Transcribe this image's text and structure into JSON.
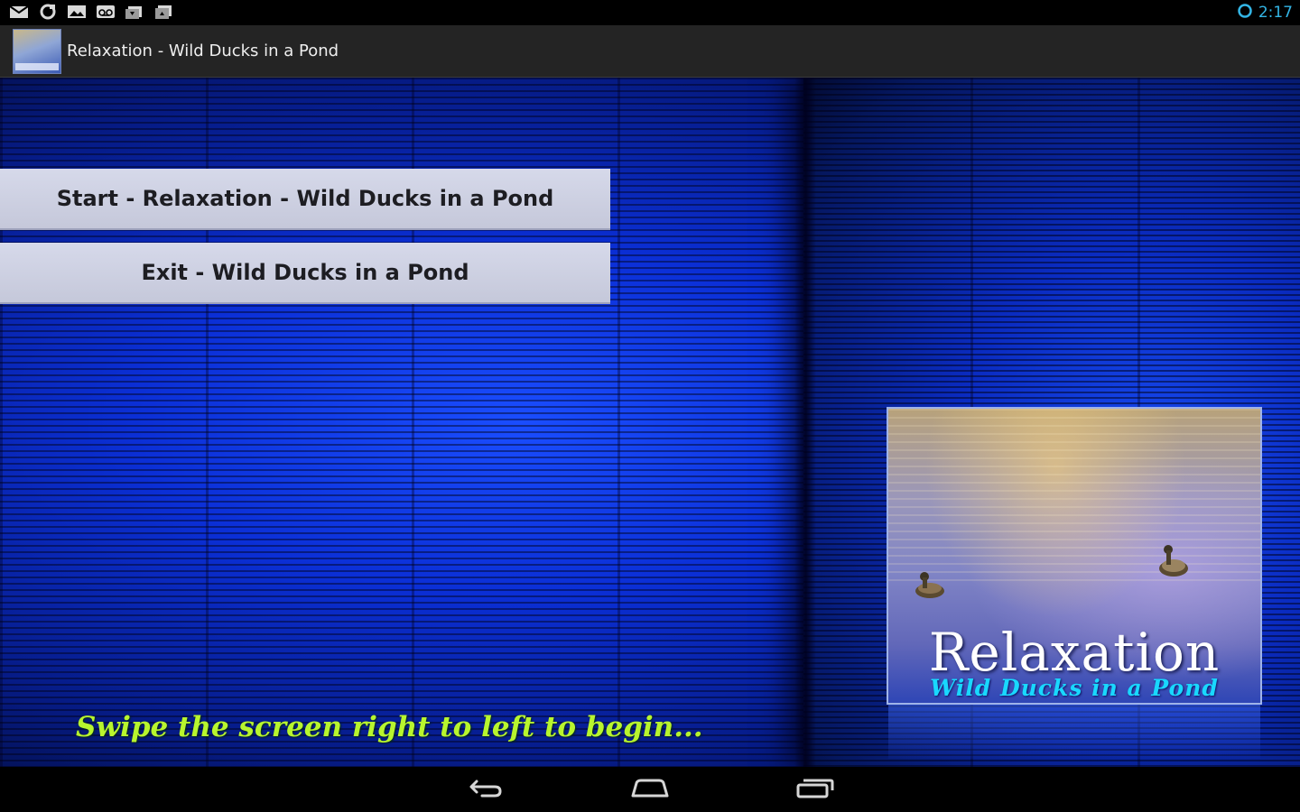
{
  "status_bar": {
    "notification_icons": [
      "mail-icon",
      "sync-icon",
      "image-icon",
      "voicemail-icon",
      "download-icon",
      "upload-icon"
    ],
    "time": "2:17",
    "sync_indicator": "circle-icon",
    "clock_color": "#33b5e5"
  },
  "action_bar": {
    "title": "Relaxation - Wild Ducks in a Pond",
    "app_icon": "app-icon"
  },
  "menu": {
    "start_label": "Start - Relaxation - Wild Ducks in a Pond",
    "exit_label": "Exit - Wild Ducks in a Pond"
  },
  "hint": {
    "text": "Swipe the screen right to left to begin...",
    "color": "#b8f52e"
  },
  "album_art": {
    "title": "Relaxation",
    "subtitle": "Wild Ducks in a Pond",
    "subtitle_color": "#19d8ff"
  },
  "nav_bar": {
    "buttons": [
      "back-icon",
      "home-icon",
      "recent-apps-icon"
    ]
  }
}
